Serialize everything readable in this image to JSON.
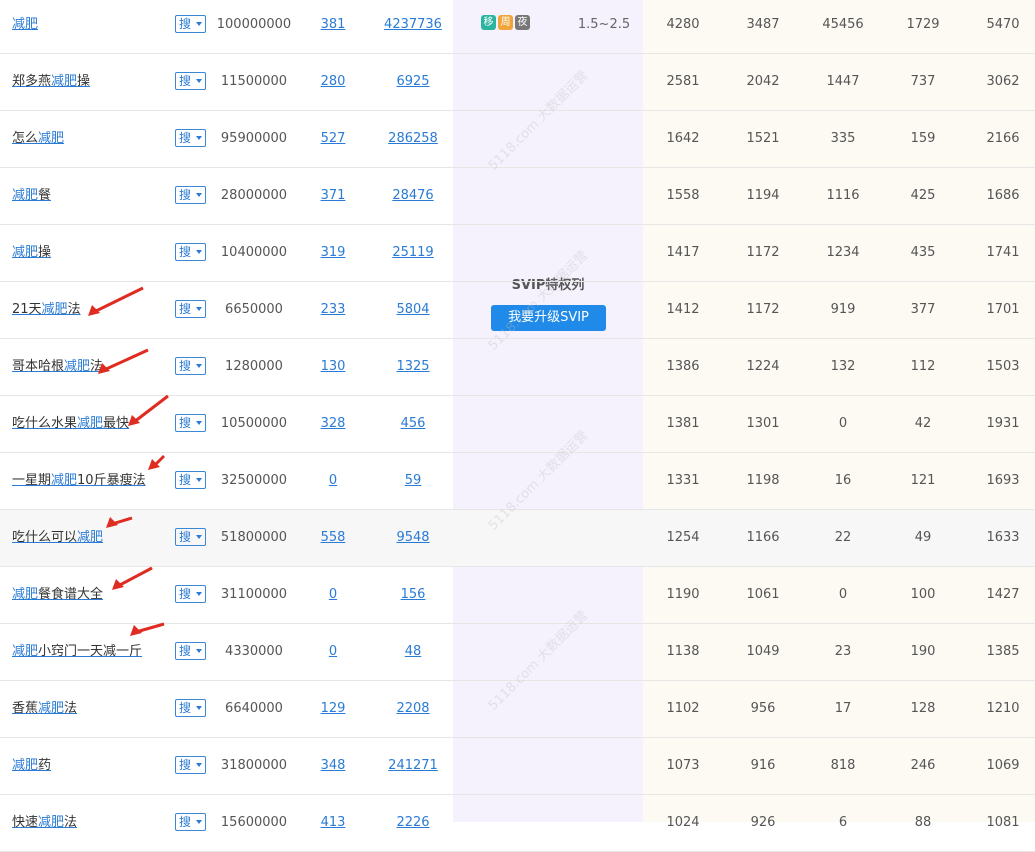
{
  "colors": {
    "link": "#2a7bd5",
    "svip_bg": "#f5f1fd",
    "warm_bg": "#fdfaf4",
    "svip_button": "#1f8ae8",
    "arrow": "#e02b20",
    "badge_mobile": "#2bb5a0",
    "badge_week": "#f0a43a",
    "badge_night": "#777777"
  },
  "search_btn_label": "搜",
  "svip": {
    "title": "SVIP特权列",
    "button": "我要升级SVIP",
    "watermark": "5118.com 大数据运营"
  },
  "badges": [
    {
      "label": "移",
      "icon": "mobile-badge"
    },
    {
      "label": "周",
      "icon": "week-badge"
    },
    {
      "label": "夜",
      "icon": "night-badge"
    }
  ],
  "rows": [
    {
      "pre": "",
      "hit": "减肥",
      "post": "",
      "idx": "100000000",
      "a": "381",
      "b": "4237736",
      "bid": "1.5~2.5",
      "n": [
        "4280",
        "3487",
        "45456",
        "1729",
        "5470"
      ],
      "arrow": false,
      "hl": false
    },
    {
      "pre": "郑多燕",
      "hit": "减肥",
      "post": "操",
      "idx": "11500000",
      "a": "280",
      "b": "6925",
      "bid": "",
      "n": [
        "2581",
        "2042",
        "1447",
        "737",
        "3062"
      ],
      "arrow": false,
      "hl": false
    },
    {
      "pre": "怎么",
      "hit": "减肥",
      "post": "",
      "idx": "95900000",
      "a": "527",
      "b": "286258",
      "bid": "",
      "n": [
        "1642",
        "1521",
        "335",
        "159",
        "2166"
      ],
      "arrow": false,
      "hl": false
    },
    {
      "pre": "",
      "hit": "减肥",
      "post": "餐",
      "idx": "28000000",
      "a": "371",
      "b": "28476",
      "bid": "",
      "n": [
        "1558",
        "1194",
        "1116",
        "425",
        "1686"
      ],
      "arrow": false,
      "hl": false
    },
    {
      "pre": "",
      "hit": "减肥",
      "post": "操",
      "idx": "10400000",
      "a": "319",
      "b": "25119",
      "bid": "",
      "n": [
        "1417",
        "1172",
        "1234",
        "435",
        "1741"
      ],
      "arrow": false,
      "hl": false
    },
    {
      "pre": "21天",
      "hit": "减肥",
      "post": "法",
      "idx": "6650000",
      "a": "233",
      "b": "5804",
      "bid": "",
      "n": [
        "1412",
        "1172",
        "919",
        "377",
        "1701"
      ],
      "arrow": true,
      "hl": false
    },
    {
      "pre": "哥本哈根",
      "hit": "减肥",
      "post": "法",
      "idx": "1280000",
      "a": "130",
      "b": "1325",
      "bid": "",
      "n": [
        "1386",
        "1224",
        "132",
        "112",
        "1503"
      ],
      "arrow": true,
      "hl": false
    },
    {
      "pre": "吃什么水果",
      "hit": "减肥",
      "post": "最快",
      "idx": "10500000",
      "a": "328",
      "b": "456",
      "bid": "",
      "n": [
        "1381",
        "1301",
        "0",
        "42",
        "1931"
      ],
      "arrow": true,
      "hl": false
    },
    {
      "pre": "一星期",
      "hit": "减肥",
      "post": "10斤暴瘦法",
      "idx": "32500000",
      "a": "0",
      "b": "59",
      "bid": "",
      "n": [
        "1331",
        "1198",
        "16",
        "121",
        "1693"
      ],
      "arrow": true,
      "hl": false
    },
    {
      "pre": "吃什么可以",
      "hit": "减肥",
      "post": "",
      "idx": "51800000",
      "a": "558",
      "b": "9548",
      "bid": "",
      "n": [
        "1254",
        "1166",
        "22",
        "49",
        "1633"
      ],
      "arrow": true,
      "hl": true
    },
    {
      "pre": "",
      "hit": "减肥",
      "post": "餐食谱大全",
      "idx": "31100000",
      "a": "0",
      "b": "156",
      "bid": "",
      "n": [
        "1190",
        "1061",
        "0",
        "100",
        "1427"
      ],
      "arrow": true,
      "hl": false
    },
    {
      "pre": "",
      "hit": "减肥",
      "post": "小窍门一天减一斤",
      "idx": "4330000",
      "a": "0",
      "b": "48",
      "bid": "",
      "n": [
        "1138",
        "1049",
        "23",
        "190",
        "1385"
      ],
      "arrow": true,
      "hl": false
    },
    {
      "pre": "香蕉",
      "hit": "减肥",
      "post": "法",
      "idx": "6640000",
      "a": "129",
      "b": "2208",
      "bid": "",
      "n": [
        "1102",
        "956",
        "17",
        "128",
        "1210"
      ],
      "arrow": false,
      "hl": false
    },
    {
      "pre": "",
      "hit": "减肥",
      "post": "药",
      "idx": "31800000",
      "a": "348",
      "b": "241271",
      "bid": "",
      "n": [
        "1073",
        "916",
        "818",
        "246",
        "1069"
      ],
      "arrow": false,
      "hl": false
    },
    {
      "pre": "快速",
      "hit": "减肥",
      "post": "法",
      "idx": "15600000",
      "a": "413",
      "b": "2226",
      "bid": "",
      "n": [
        "1024",
        "926",
        "6",
        "88",
        "1081"
      ],
      "arrow": false,
      "hl": false
    }
  ]
}
